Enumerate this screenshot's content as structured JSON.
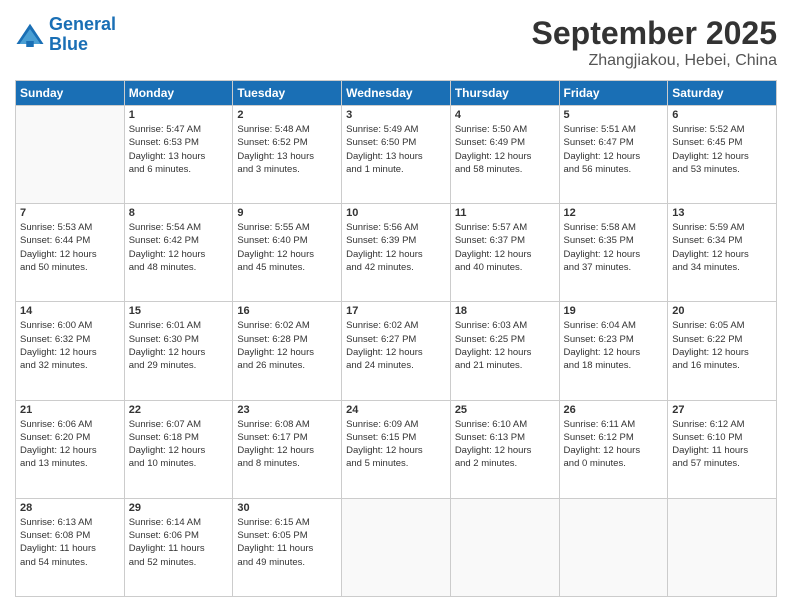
{
  "logo": {
    "line1": "General",
    "line2": "Blue"
  },
  "title": "September 2025",
  "location": "Zhangjiakou, Hebei, China",
  "headers": [
    "Sunday",
    "Monday",
    "Tuesday",
    "Wednesday",
    "Thursday",
    "Friday",
    "Saturday"
  ],
  "weeks": [
    [
      {
        "day": "",
        "info": ""
      },
      {
        "day": "1",
        "info": "Sunrise: 5:47 AM\nSunset: 6:53 PM\nDaylight: 13 hours\nand 6 minutes."
      },
      {
        "day": "2",
        "info": "Sunrise: 5:48 AM\nSunset: 6:52 PM\nDaylight: 13 hours\nand 3 minutes."
      },
      {
        "day": "3",
        "info": "Sunrise: 5:49 AM\nSunset: 6:50 PM\nDaylight: 13 hours\nand 1 minute."
      },
      {
        "day": "4",
        "info": "Sunrise: 5:50 AM\nSunset: 6:49 PM\nDaylight: 12 hours\nand 58 minutes."
      },
      {
        "day": "5",
        "info": "Sunrise: 5:51 AM\nSunset: 6:47 PM\nDaylight: 12 hours\nand 56 minutes."
      },
      {
        "day": "6",
        "info": "Sunrise: 5:52 AM\nSunset: 6:45 PM\nDaylight: 12 hours\nand 53 minutes."
      }
    ],
    [
      {
        "day": "7",
        "info": "Sunrise: 5:53 AM\nSunset: 6:44 PM\nDaylight: 12 hours\nand 50 minutes."
      },
      {
        "day": "8",
        "info": "Sunrise: 5:54 AM\nSunset: 6:42 PM\nDaylight: 12 hours\nand 48 minutes."
      },
      {
        "day": "9",
        "info": "Sunrise: 5:55 AM\nSunset: 6:40 PM\nDaylight: 12 hours\nand 45 minutes."
      },
      {
        "day": "10",
        "info": "Sunrise: 5:56 AM\nSunset: 6:39 PM\nDaylight: 12 hours\nand 42 minutes."
      },
      {
        "day": "11",
        "info": "Sunrise: 5:57 AM\nSunset: 6:37 PM\nDaylight: 12 hours\nand 40 minutes."
      },
      {
        "day": "12",
        "info": "Sunrise: 5:58 AM\nSunset: 6:35 PM\nDaylight: 12 hours\nand 37 minutes."
      },
      {
        "day": "13",
        "info": "Sunrise: 5:59 AM\nSunset: 6:34 PM\nDaylight: 12 hours\nand 34 minutes."
      }
    ],
    [
      {
        "day": "14",
        "info": "Sunrise: 6:00 AM\nSunset: 6:32 PM\nDaylight: 12 hours\nand 32 minutes."
      },
      {
        "day": "15",
        "info": "Sunrise: 6:01 AM\nSunset: 6:30 PM\nDaylight: 12 hours\nand 29 minutes."
      },
      {
        "day": "16",
        "info": "Sunrise: 6:02 AM\nSunset: 6:28 PM\nDaylight: 12 hours\nand 26 minutes."
      },
      {
        "day": "17",
        "info": "Sunrise: 6:02 AM\nSunset: 6:27 PM\nDaylight: 12 hours\nand 24 minutes."
      },
      {
        "day": "18",
        "info": "Sunrise: 6:03 AM\nSunset: 6:25 PM\nDaylight: 12 hours\nand 21 minutes."
      },
      {
        "day": "19",
        "info": "Sunrise: 6:04 AM\nSunset: 6:23 PM\nDaylight: 12 hours\nand 18 minutes."
      },
      {
        "day": "20",
        "info": "Sunrise: 6:05 AM\nSunset: 6:22 PM\nDaylight: 12 hours\nand 16 minutes."
      }
    ],
    [
      {
        "day": "21",
        "info": "Sunrise: 6:06 AM\nSunset: 6:20 PM\nDaylight: 12 hours\nand 13 minutes."
      },
      {
        "day": "22",
        "info": "Sunrise: 6:07 AM\nSunset: 6:18 PM\nDaylight: 12 hours\nand 10 minutes."
      },
      {
        "day": "23",
        "info": "Sunrise: 6:08 AM\nSunset: 6:17 PM\nDaylight: 12 hours\nand 8 minutes."
      },
      {
        "day": "24",
        "info": "Sunrise: 6:09 AM\nSunset: 6:15 PM\nDaylight: 12 hours\nand 5 minutes."
      },
      {
        "day": "25",
        "info": "Sunrise: 6:10 AM\nSunset: 6:13 PM\nDaylight: 12 hours\nand 2 minutes."
      },
      {
        "day": "26",
        "info": "Sunrise: 6:11 AM\nSunset: 6:12 PM\nDaylight: 12 hours\nand 0 minutes."
      },
      {
        "day": "27",
        "info": "Sunrise: 6:12 AM\nSunset: 6:10 PM\nDaylight: 11 hours\nand 57 minutes."
      }
    ],
    [
      {
        "day": "28",
        "info": "Sunrise: 6:13 AM\nSunset: 6:08 PM\nDaylight: 11 hours\nand 54 minutes."
      },
      {
        "day": "29",
        "info": "Sunrise: 6:14 AM\nSunset: 6:06 PM\nDaylight: 11 hours\nand 52 minutes."
      },
      {
        "day": "30",
        "info": "Sunrise: 6:15 AM\nSunset: 6:05 PM\nDaylight: 11 hours\nand 49 minutes."
      },
      {
        "day": "",
        "info": ""
      },
      {
        "day": "",
        "info": ""
      },
      {
        "day": "",
        "info": ""
      },
      {
        "day": "",
        "info": ""
      }
    ]
  ]
}
